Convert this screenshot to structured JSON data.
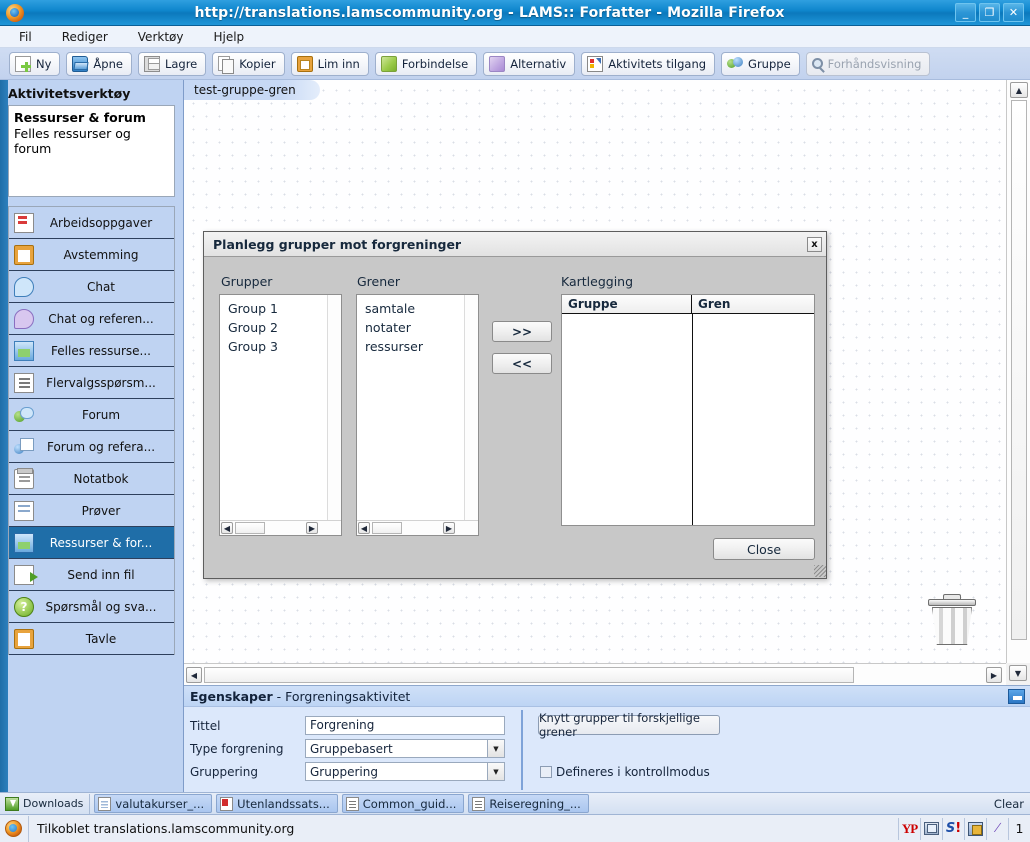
{
  "window": {
    "title": "http://translations.lamscommunity.org - LAMS:: Forfatter - Mozilla Firefox",
    "minimize": "_",
    "maximize": "❐",
    "close": "✕"
  },
  "menu": {
    "items": [
      "Fil",
      "Rediger",
      "Verktøy",
      "Hjelp"
    ]
  },
  "toolbar": {
    "buttons": [
      {
        "label": "Ny",
        "icon": "new-document-icon",
        "disabled": false
      },
      {
        "label": "Åpne",
        "icon": "open-folder-icon",
        "disabled": false
      },
      {
        "label": "Lagre",
        "icon": "save-disk-icon",
        "disabled": false
      },
      {
        "label": "Kopier",
        "icon": "copy-icon",
        "disabled": false
      },
      {
        "label": "Lim inn",
        "icon": "paste-clipboard-icon",
        "disabled": false
      },
      {
        "label": "Forbindelse",
        "icon": "green-pencil-icon",
        "disabled": false
      },
      {
        "label": "Alternativ",
        "icon": "purple-pencil-icon",
        "disabled": false
      },
      {
        "label": "Aktivitets tilgang",
        "icon": "traffic-light-icon",
        "disabled": false
      },
      {
        "label": "Gruppe",
        "icon": "group-people-icon",
        "disabled": false
      },
      {
        "label": "Forhåndsvisning",
        "icon": "magnifier-icon",
        "disabled": true
      }
    ]
  },
  "sidebar": {
    "title": "Aktivitetsverktøy",
    "info": {
      "heading": "Ressurser & forum",
      "description": "Felles ressurser og forum"
    },
    "items": [
      {
        "label": "Arbeidsoppgaver",
        "icon": "task-icon",
        "selected": false
      },
      {
        "label": "Avstemming",
        "icon": "vote-icon",
        "selected": false
      },
      {
        "label": "Chat",
        "icon": "chat-bubble-icon",
        "selected": false
      },
      {
        "label": "Chat og referen...",
        "icon": "chat-reference-icon",
        "selected": false
      },
      {
        "label": "Felles ressurse...",
        "icon": "shared-resources-icon",
        "selected": false
      },
      {
        "label": "Flervalgsspørsm...",
        "icon": "multiple-choice-icon",
        "selected": false
      },
      {
        "label": "Forum",
        "icon": "forum-icon",
        "selected": false
      },
      {
        "label": "Forum og refera...",
        "icon": "forum-reference-icon",
        "selected": false
      },
      {
        "label": "Notatbok",
        "icon": "notebook-icon",
        "selected": false
      },
      {
        "label": "Prøver",
        "icon": "quiz-icon",
        "selected": false
      },
      {
        "label": "Ressurser & for...",
        "icon": "resources-forum-icon",
        "selected": true
      },
      {
        "label": "Send inn fil",
        "icon": "submit-file-icon",
        "selected": false
      },
      {
        "label": "Spørsmål og sva...",
        "icon": "question-answer-icon",
        "selected": false
      },
      {
        "label": "Tavle",
        "icon": "whiteboard-icon",
        "selected": false
      }
    ]
  },
  "canvas": {
    "tab_label": "test-gruppe-gren",
    "trash_icon": "trash-can-icon",
    "vscroll_up": "▲",
    "vscroll_down": "▼",
    "hscroll_left": "◀",
    "hscroll_right": "▶"
  },
  "dialog": {
    "title": "Planlegg grupper mot forgreninger",
    "close_icon": "x",
    "groups": {
      "label": "Grupper",
      "items": [
        "Group 1",
        "Group 2",
        "Group 3"
      ],
      "scroll_left": "◀",
      "scroll_right": "▶"
    },
    "branches": {
      "label": "Grener",
      "items": [
        "samtale",
        "notater",
        "ressurser"
      ],
      "scroll_left": "◀",
      "scroll_right": "▶"
    },
    "transfer": {
      "add": ">>",
      "remove": "<<"
    },
    "mapping": {
      "label": "Kartlegging",
      "columns": [
        "Gruppe",
        "Gren"
      ],
      "rows": []
    },
    "close_button": "Close"
  },
  "properties": {
    "heading_bold": "Egenskaper",
    "heading_rest": " - Forgreningsaktivitet",
    "minimize_icon": "minimize-panel-icon",
    "fields": [
      {
        "label": "Tittel",
        "type": "text",
        "value": "Forgrening"
      },
      {
        "label": "Type forgrening",
        "type": "select",
        "value": "Gruppebasert"
      },
      {
        "label": "Gruppering",
        "type": "select",
        "value": "Gruppering"
      }
    ],
    "link_button": "Knytt grupper til forskjellige  grener",
    "checkbox": {
      "label": "Defineres i kontrollmodus",
      "checked": false
    }
  },
  "taskbar": {
    "downloads_label": "Downloads",
    "downloads_icon": "download-arrow-icon",
    "items": [
      {
        "label": "valutakurser_...",
        "icon": "spreadsheet-icon"
      },
      {
        "label": "Utenlandssats...",
        "icon": "pdf-icon"
      },
      {
        "label": "Common_guid...",
        "icon": "document-icon"
      },
      {
        "label": "Reiseregning_...",
        "icon": "document-icon"
      }
    ],
    "clear_label": "Clear"
  },
  "statusbar": {
    "icon": "firefox-icon",
    "text": "Tilkoblet translations.lamscommunity.org",
    "tray": [
      {
        "name": "yahoo-pops-icon",
        "label": "YP"
      },
      {
        "name": "window-manager-icon",
        "label": ""
      },
      {
        "name": "skype-icon",
        "label": "S!"
      },
      {
        "name": "notes-icon",
        "label": ""
      },
      {
        "name": "pen-icon",
        "label": "↗"
      },
      {
        "name": "workspace-number",
        "label": "1"
      }
    ]
  },
  "colors": {
    "titlebar": "#1f8ccd",
    "sidebar_bg": "#bfd3f2",
    "selected_item": "#1f6ea8",
    "dialog_bg": "#c8c8c8",
    "props_bg": "#dce8fb"
  }
}
